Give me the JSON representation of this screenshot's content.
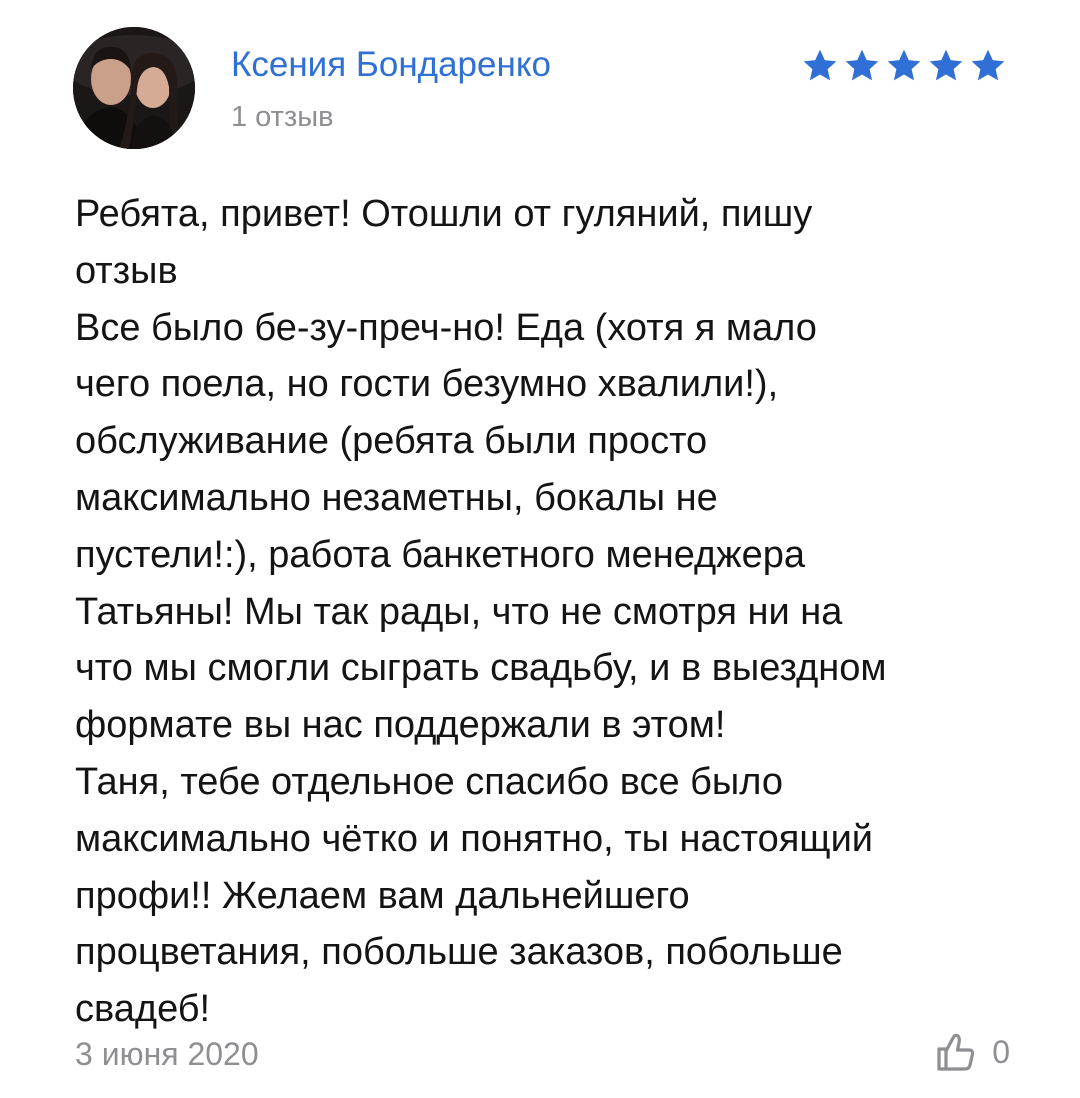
{
  "review": {
    "author": {
      "name": "Ксения Бондаренко",
      "reviews_count": "1 отзыв",
      "avatar_icon": "user-photo"
    },
    "rating": {
      "value": 5,
      "max": 5,
      "star_color": "#2f6fd6"
    },
    "text": "Ребята, привет! Отошли от гуляний, пишу\nотзыв\nВсе было бе-зу-преч-но! Еда (хотя я мало\nчего поела, но гости безумно хвалили!),\nобслуживание (ребята были просто\nмаксимально незаметны, бокалы не\nпустели!:), работа банкетного менеджера\nТатьяны! Мы так рады, что не смотря ни на\nчто мы смогли сыграть свадьбу, и в выездном\nформате вы нас поддержали в этом!\nТаня, тебе отдельное спасибо  все было\nмаксимально чётко и понятно, ты настоящий\nпрофи!! Желаем вам дальнейшего\nпроцветания, побольше заказов, побольше\nсвадеб!",
    "date": "3 июня 2020",
    "likes": {
      "icon": "thumbs-up-icon",
      "count": "0"
    }
  },
  "colors": {
    "accent": "#2f6fd6",
    "muted": "#8e8e93",
    "text": "#141414",
    "background": "#ffffff"
  }
}
